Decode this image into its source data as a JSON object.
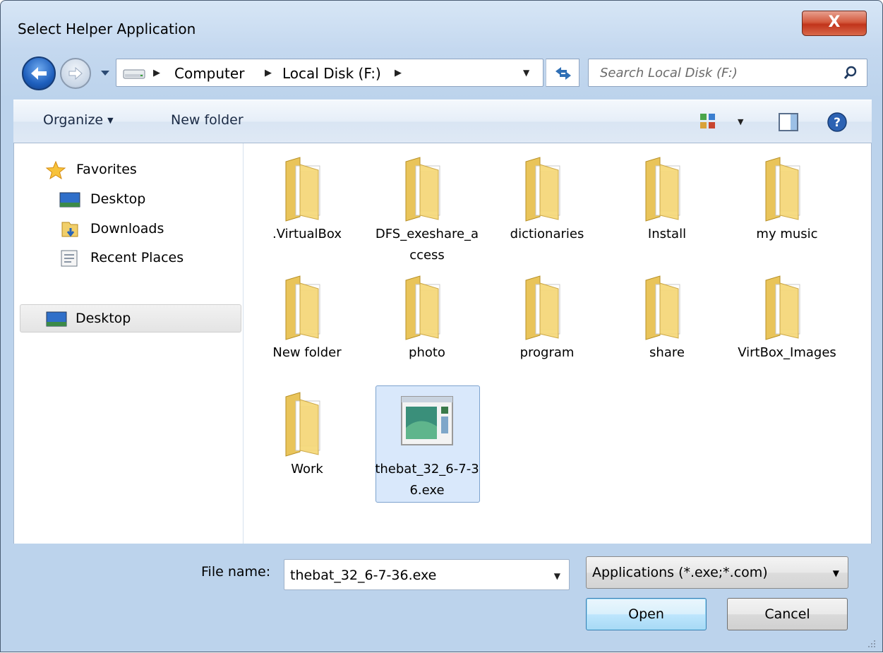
{
  "window": {
    "title": "Select Helper Application",
    "close_label": "X"
  },
  "address": {
    "crumbs": [
      "Computer",
      "Local Disk (F:)"
    ],
    "search_placeholder": "Search Local Disk (F:)"
  },
  "toolbar": {
    "organize_label": "Organize",
    "new_folder_label": "New folder"
  },
  "sidebar": {
    "favorites_label": "Favorites",
    "items": [
      {
        "label": "Desktop",
        "icon": "desktop-icon"
      },
      {
        "label": "Downloads",
        "icon": "downloads-icon"
      },
      {
        "label": "Recent Places",
        "icon": "recent-places-icon"
      }
    ],
    "selected_label": "Desktop"
  },
  "files": [
    {
      "name": ".VirtualBox",
      "icon": "folder-icon"
    },
    {
      "name": "DFS_exeshare_access",
      "icon": "folder-icon"
    },
    {
      "name": "dictionaries",
      "icon": "folder-icon"
    },
    {
      "name": "Install",
      "icon": "folder-icon"
    },
    {
      "name": "my music",
      "icon": "folder-icon"
    },
    {
      "name": "New folder",
      "icon": "folder-icon"
    },
    {
      "name": "photo",
      "icon": "folder-icon"
    },
    {
      "name": "program",
      "icon": "folder-icon"
    },
    {
      "name": "share",
      "icon": "folder-icon"
    },
    {
      "name": "VirtBox_Images",
      "icon": "folder-icon"
    },
    {
      "name": "Work",
      "icon": "folder-icon"
    },
    {
      "name": "thebat_32_6-7-36.exe",
      "icon": "exe-file-icon",
      "selected": true
    }
  ],
  "bottom": {
    "file_name_label": "File name:",
    "file_name_value": "thebat_32_6-7-36.exe",
    "file_type_value": "Applications (*.exe;*.com)",
    "open_label": "Open",
    "cancel_label": "Cancel"
  },
  "colors": {
    "accent": "#1e5fbd",
    "selection": "#d9e8fb",
    "folder": "#f2d574"
  }
}
